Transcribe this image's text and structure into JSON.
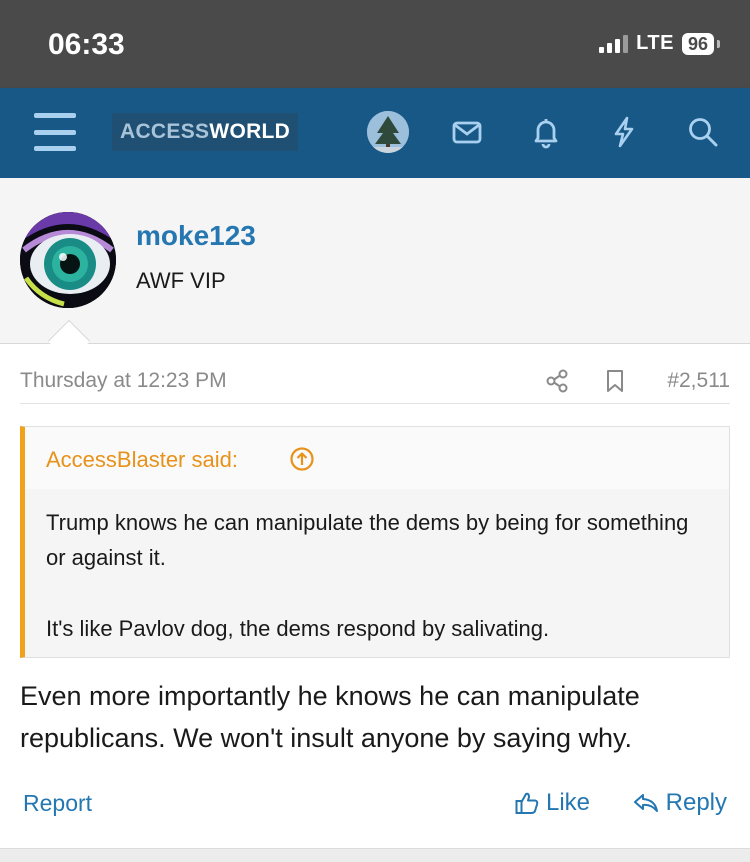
{
  "status_bar": {
    "time": "06:33",
    "network": "LTE",
    "battery": "96"
  },
  "navbar": {
    "logo_part1": "ACCESS",
    "logo_part2": "WORLD",
    "icons": [
      "menu-icon",
      "avatar",
      "mail-icon",
      "bell-icon",
      "bolt-icon",
      "search-icon"
    ]
  },
  "post": {
    "username": "moke123",
    "user_title": "AWF VIP",
    "date": "Thursday at 12:23 PM",
    "post_number": "#2,511",
    "quote": {
      "author_said": "AccessBlaster said:",
      "line1": "Trump knows he can manipulate the dems by being for something or against it.",
      "line2": "It's like Pavlov dog, the dems respond by salivating."
    },
    "body": "Even more importantly he knows he can manipulate republicans. We won't insult anyone by saying why.",
    "actions": {
      "report": "Report",
      "like": "Like",
      "reply": "Reply"
    }
  },
  "colors": {
    "navbar": "#185886",
    "link": "#2577b1",
    "quote_accent": "#f0a21b",
    "status_bar": "#4a4a4a"
  }
}
